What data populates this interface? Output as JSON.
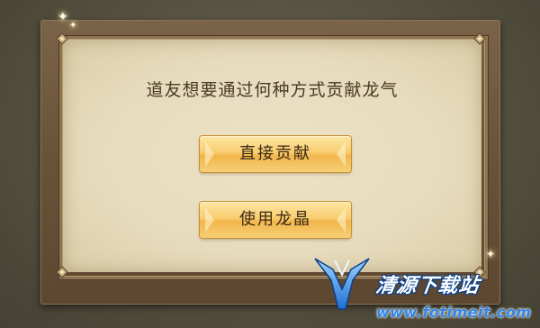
{
  "dialog": {
    "question": "道友想要通过何种方式贡献龙气",
    "buttons": {
      "direct_label": "直接贡献",
      "crystal_label": "使用龙晶"
    }
  },
  "watermark": {
    "name": "清源下载站",
    "url": "www.fotimeit.com"
  },
  "colors": {
    "panel": "#e6dbbd",
    "frame": "#6a5238",
    "button": "#f8cd70",
    "text": "#4a3a25",
    "watermark_blue": "#2f86e6"
  },
  "icons": [
    "corner-ornament-icon",
    "sparkle-icon",
    "watermark-logo-icon"
  ]
}
